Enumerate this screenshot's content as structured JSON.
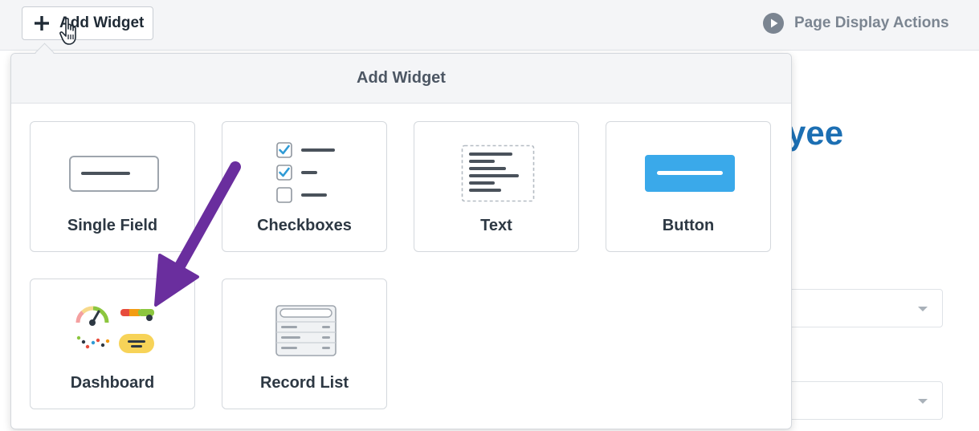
{
  "toolbar": {
    "add_widget_label": "Add Widget",
    "page_display_actions_label": "Page Display Actions"
  },
  "background": {
    "heading_fragment": "yee"
  },
  "popup": {
    "title": "Add Widget",
    "widgets": [
      {
        "label": "Single Field",
        "icon": "single-field-icon"
      },
      {
        "label": "Checkboxes",
        "icon": "checkboxes-icon"
      },
      {
        "label": "Text",
        "icon": "text-icon"
      },
      {
        "label": "Button",
        "icon": "button-icon"
      },
      {
        "label": "Dashboard",
        "icon": "dashboard-icon"
      },
      {
        "label": "Record List",
        "icon": "record-list-icon"
      }
    ]
  },
  "colors": {
    "accent_blue": "#1c6fb3",
    "button_widget_blue": "#3aa9ea",
    "annotation_purple": "#6a2e9e",
    "checkbox_blue": "#2f9bd6"
  }
}
